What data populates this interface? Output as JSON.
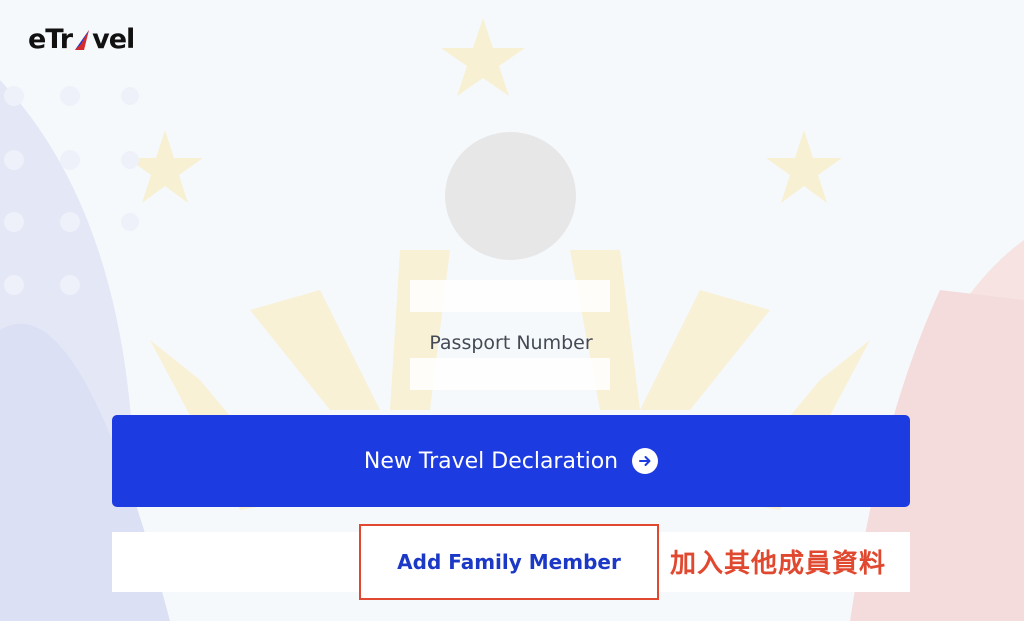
{
  "header": {
    "logo_text_left": "eTr",
    "logo_text_right": "vel"
  },
  "profile": {
    "passport_label": "Passport Number"
  },
  "actions": {
    "new_declaration_label": "New Travel Declaration",
    "add_family_label": "Add Family Member"
  },
  "annotation": {
    "text": "加入其他成員資料"
  },
  "colors": {
    "primary": "#1c3be0",
    "highlight": "#e0492f",
    "link": "#1b38c7"
  },
  "icons": {
    "logo_mark": "paper-plane-icon",
    "button_arrow": "arrow-right-circle-icon"
  }
}
